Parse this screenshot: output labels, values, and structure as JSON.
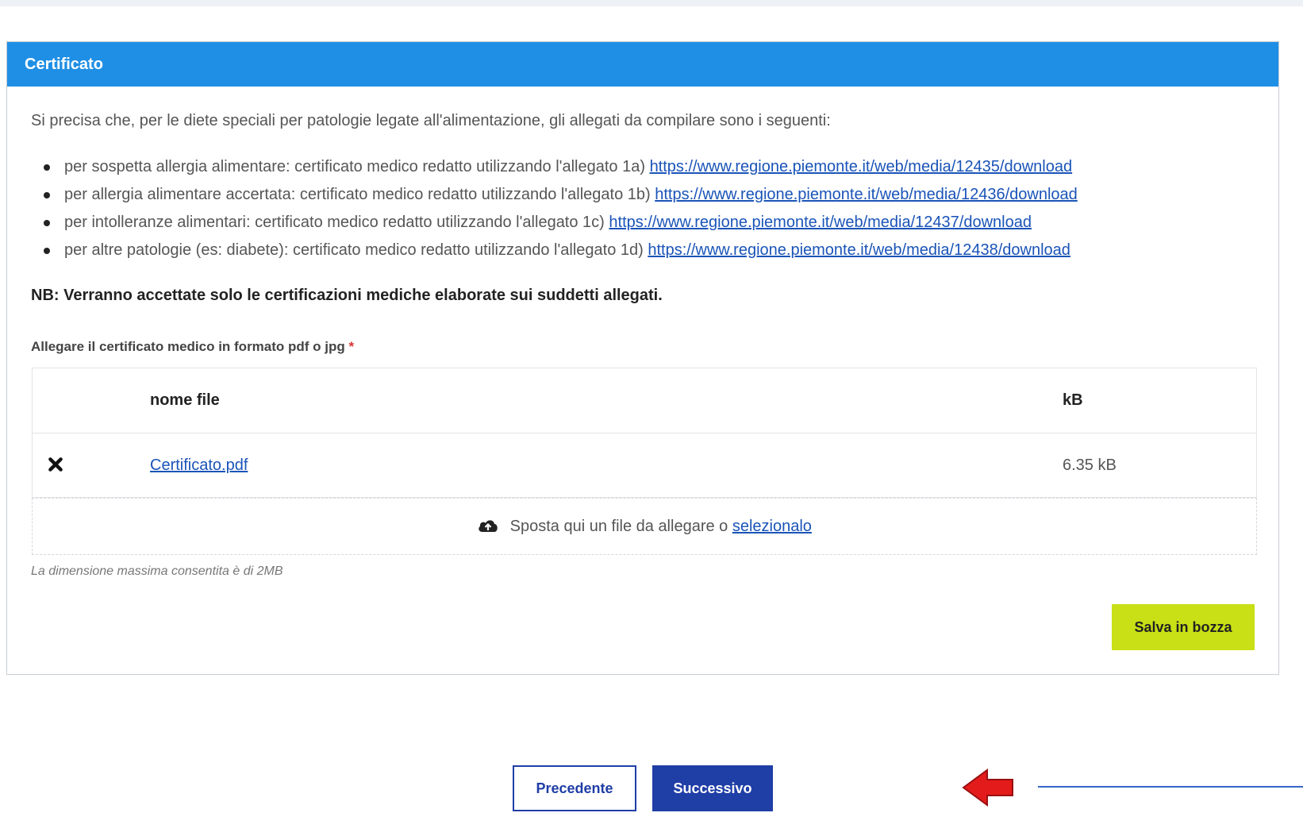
{
  "card": {
    "title": "Certificato",
    "intro": "Si precisa che, per le diete speciali per patologie legate all'alimentazione, gli allegati da compilare sono i seguenti:",
    "items": [
      {
        "text": "per sospetta allergia alimentare: certificato medico redatto utilizzando l'allegato 1a)",
        "link": "https://www.regione.piemonte.it/web/media/12435/download"
      },
      {
        "text": "per allergia alimentare accertata: certificato medico redatto utilizzando l'allegato 1b)",
        "link": "https://www.regione.piemonte.it/web/media/12436/download"
      },
      {
        "text": "per intolleranze alimentari: certificato medico redatto utilizzando l'allegato 1c)",
        "link": "https://www.regione.piemonte.it/web/media/12437/download"
      },
      {
        "text": "per altre patologie (es: diabete): certificato medico redatto utilizzando l'allegato 1d)",
        "link": "https://www.regione.piemonte.it/web/media/12438/download"
      }
    ],
    "nb": "NB: Verranno accettate solo le certificazioni mediche elaborate sui suddetti allegati.",
    "attach_label": "Allegare il certificato medico in formato pdf o jpg",
    "required_mark": "*",
    "table": {
      "col_name": "nome file",
      "col_size": "kB",
      "rows": [
        {
          "name": "Certificato.pdf",
          "size": "6.35 kB"
        }
      ]
    },
    "dropzone": {
      "text": "Sposta qui un file da allegare o",
      "link": "selezionalo",
      "icon": "cloud-upload-icon"
    },
    "note": "La dimensione massima consentita è di 2MB",
    "save_draft_label": "Salva in bozza"
  },
  "nav": {
    "prev_label": "Precedente",
    "next_label": "Successivo"
  },
  "colors": {
    "header": "#1f8fe5",
    "primary": "#1f3ea6",
    "draft_button": "#c8e015",
    "link": "#1a54b8",
    "arrow": "#e41b1b"
  }
}
